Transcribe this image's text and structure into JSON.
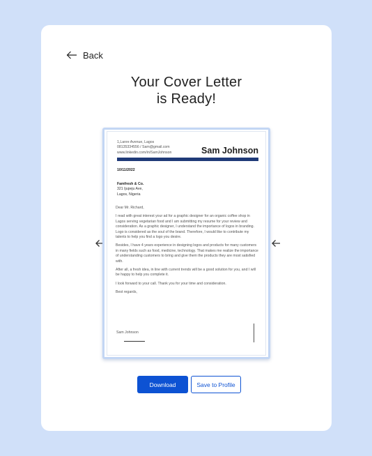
{
  "header": {
    "back_label": "Back"
  },
  "title": {
    "line1": "Your Cover Letter",
    "line2": "is Ready!"
  },
  "letter": {
    "contact": [
      "1,Lanre Avenue, Lagos",
      "08135334556 / Sam@gmail.com",
      "www.linkedin.com/in/SamJohnson"
    ],
    "name": "Sam Johnson",
    "date": "10/11/2022",
    "recipient_company": "Famfresh & Co.",
    "recipient_address": [
      "321 Ijupeju Ave,",
      "Lagos, Nigeria"
    ],
    "greeting": "Dear Mr. Richard,",
    "paragraphs": [
      "I read with great interest your ad for a graphic designer for an organic coffee shop in Lagos serving vegetarian food and I am submitting my resume for your review and consideration. As a graphic designer, I understand the importance of logos in branding. Logo is considered as the soul of the brand. Therefore, I would like to contribute my talents to help you find a logo you desire.",
      "Besides, I have 4 years experience in designing logos and products for many customers in many fields such as food, medicine, technology. That makes me realize the importance of understanding customers to bring and give them the products they are most satisfied with.",
      "After all, a fresh idea, in line with current trends will be a good solution for you, and I will be happy to help you complete it.",
      "I look forward to your call. Thank you for your time and consideration.",
      "Best regards,"
    ],
    "signature": "Sam Johnson"
  },
  "actions": {
    "download_label": "Download",
    "save_label": "Save to Profile"
  },
  "colors": {
    "accent": "#0d52d3",
    "letterhead_bar": "#1f3a78",
    "page_bg": "#d0e0f9"
  },
  "icons": {
    "back": "arrow-left-icon",
    "prev": "arrow-left-icon",
    "next": "arrow-left-icon"
  }
}
